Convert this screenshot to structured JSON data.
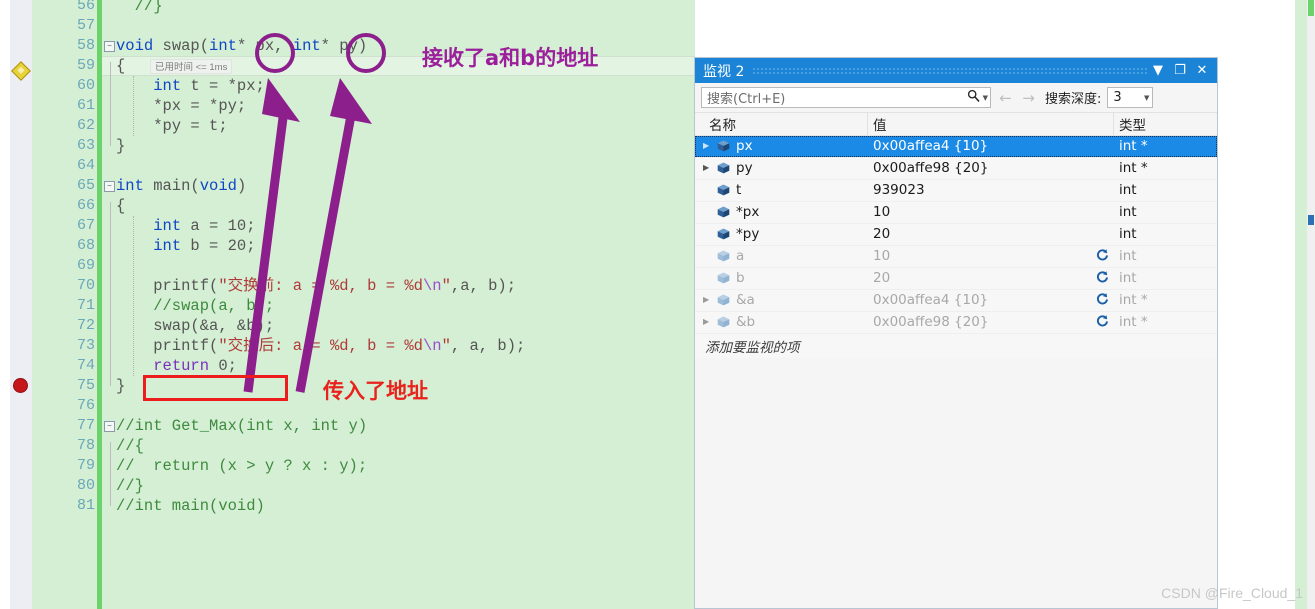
{
  "editor": {
    "language": "c",
    "theme_background": "#d4efd4",
    "first_line": 56,
    "gutter_markers": {
      "current_statement_line": 59,
      "breakpoint_line": 72
    },
    "elapsed_tooltip": "已用时间 <= 1ms",
    "lines": [
      {
        "n": 56,
        "segments": [
          {
            "t": "  //}",
            "c": "cmt"
          }
        ],
        "fold": false
      },
      {
        "n": 57,
        "segments": [
          {
            "t": "",
            "c": "plain"
          }
        ],
        "fold": false
      },
      {
        "n": 58,
        "segments": [
          {
            "t": "void ",
            "c": "kw"
          },
          {
            "t": "swap",
            "c": "plain"
          },
          {
            "t": "(",
            "c": "plain"
          },
          {
            "t": "int",
            "c": "kw"
          },
          {
            "t": "* px, ",
            "c": "plain"
          },
          {
            "t": "int",
            "c": "kw"
          },
          {
            "t": "* py)",
            "c": "plain"
          }
        ],
        "fold": true
      },
      {
        "n": 59,
        "segments": [
          {
            "t": "{",
            "c": "plain"
          }
        ],
        "fold": false
      },
      {
        "n": 60,
        "segments": [
          {
            "t": "    ",
            "c": "plain"
          },
          {
            "t": "int",
            "c": "kw"
          },
          {
            "t": " t = *px;",
            "c": "plain"
          }
        ],
        "fold": false
      },
      {
        "n": 61,
        "segments": [
          {
            "t": "    *px = *py;",
            "c": "plain"
          }
        ],
        "fold": false
      },
      {
        "n": 62,
        "segments": [
          {
            "t": "    *py = t;",
            "c": "plain"
          }
        ],
        "fold": false
      },
      {
        "n": 63,
        "segments": [
          {
            "t": "}",
            "c": "plain"
          }
        ],
        "fold": false
      },
      {
        "n": 64,
        "segments": [
          {
            "t": "",
            "c": "plain"
          }
        ],
        "fold": false
      },
      {
        "n": 65,
        "segments": [
          {
            "t": "int",
            "c": "kw"
          },
          {
            "t": " main(",
            "c": "plain"
          },
          {
            "t": "void",
            "c": "kw"
          },
          {
            "t": ")",
            "c": "plain"
          }
        ],
        "fold": true
      },
      {
        "n": 66,
        "segments": [
          {
            "t": "{",
            "c": "plain"
          }
        ],
        "fold": false
      },
      {
        "n": 67,
        "segments": [
          {
            "t": "    ",
            "c": "plain"
          },
          {
            "t": "int",
            "c": "kw"
          },
          {
            "t": " a = 10;",
            "c": "plain"
          }
        ],
        "fold": false
      },
      {
        "n": 68,
        "segments": [
          {
            "t": "    ",
            "c": "plain"
          },
          {
            "t": "int",
            "c": "kw"
          },
          {
            "t": " b = 20;",
            "c": "plain"
          }
        ],
        "fold": false
      },
      {
        "n": 69,
        "segments": [
          {
            "t": "",
            "c": "plain"
          }
        ],
        "fold": false
      },
      {
        "n": 70,
        "segments": [
          {
            "t": "    printf(",
            "c": "plain"
          },
          {
            "t": "\"交换前: a = %d, b = %d",
            "c": "str"
          },
          {
            "t": "\\n",
            "c": "esc"
          },
          {
            "t": "\"",
            "c": "str"
          },
          {
            "t": ",a, b);",
            "c": "plain"
          }
        ],
        "fold": false
      },
      {
        "n": 71,
        "segments": [
          {
            "t": "    //swap(a, b);",
            "c": "cmt"
          }
        ],
        "fold": false
      },
      {
        "n": 72,
        "segments": [
          {
            "t": "    swap(&a, &b);",
            "c": "plain"
          }
        ],
        "fold": false
      },
      {
        "n": 73,
        "segments": [
          {
            "t": "    printf(",
            "c": "plain"
          },
          {
            "t": "\"交换后: a = %d, b = %d",
            "c": "str"
          },
          {
            "t": "\\n",
            "c": "esc"
          },
          {
            "t": "\"",
            "c": "str"
          },
          {
            "t": ", a, b);",
            "c": "plain"
          }
        ],
        "fold": false
      },
      {
        "n": 74,
        "segments": [
          {
            "t": "    ",
            "c": "plain"
          },
          {
            "t": "return",
            "c": "kw2"
          },
          {
            "t": " 0;",
            "c": "plain"
          }
        ],
        "fold": false
      },
      {
        "n": 75,
        "segments": [
          {
            "t": "}",
            "c": "plain"
          }
        ],
        "fold": false
      },
      {
        "n": 76,
        "segments": [
          {
            "t": "",
            "c": "plain"
          }
        ],
        "fold": false
      },
      {
        "n": 77,
        "segments": [
          {
            "t": "//int Get_Max(int x, int y)",
            "c": "cmt"
          }
        ],
        "fold": true
      },
      {
        "n": 78,
        "segments": [
          {
            "t": "//{",
            "c": "cmt"
          }
        ],
        "fold": false
      },
      {
        "n": 79,
        "segments": [
          {
            "t": "//  return (x > y ? x : y);",
            "c": "cmt"
          }
        ],
        "fold": false
      },
      {
        "n": 80,
        "segments": [
          {
            "t": "//}",
            "c": "cmt"
          }
        ],
        "fold": false
      },
      {
        "n": 81,
        "segments": [
          {
            "t": "//int main(void)",
            "c": "cmt"
          }
        ],
        "fold": false
      }
    ]
  },
  "annotations": {
    "top_note": "接收了a和b的地址",
    "bottom_note": "传入了地址",
    "note_color_purple": "#9b1f9b",
    "note_color_red": "#e8221c",
    "arrow_color": "#8c1f8c",
    "highlight_box_color": "#ee1d1d"
  },
  "watch": {
    "title": "监视 2",
    "title_bar_color": "#1b84d6",
    "buttons": {
      "dropdown": "▼",
      "maximize": "❐",
      "close": "✕"
    },
    "toolbar": {
      "search_placeholder": "搜索(Ctrl+E)",
      "search_value": "",
      "search_icon": "search-icon",
      "back_arrow": "←",
      "forward_arrow": "→",
      "depth_label": "搜索深度:",
      "depth_value": "3"
    },
    "columns": [
      "名称",
      "值",
      "类型"
    ],
    "add_item_placeholder": "添加要监视的项",
    "rows": [
      {
        "name": "px",
        "value": "0x00affea4 {10}",
        "type": "int *",
        "selected": true,
        "stale": false,
        "expandable": true,
        "refresh": false
      },
      {
        "name": "py",
        "value": "0x00affe98 {20}",
        "type": "int *",
        "selected": false,
        "stale": false,
        "expandable": true,
        "refresh": false
      },
      {
        "name": "t",
        "value": "939023",
        "type": "int",
        "selected": false,
        "stale": false,
        "expandable": false,
        "refresh": false
      },
      {
        "name": "*px",
        "value": "10",
        "type": "int",
        "selected": false,
        "stale": false,
        "expandable": false,
        "refresh": false
      },
      {
        "name": "*py",
        "value": "20",
        "type": "int",
        "selected": false,
        "stale": false,
        "expandable": false,
        "refresh": false
      },
      {
        "name": "a",
        "value": "10",
        "type": "int",
        "selected": false,
        "stale": true,
        "expandable": false,
        "refresh": true
      },
      {
        "name": "b",
        "value": "20",
        "type": "int",
        "selected": false,
        "stale": true,
        "expandable": false,
        "refresh": true
      },
      {
        "name": "&a",
        "value": "0x00affea4 {10}",
        "type": "int *",
        "selected": false,
        "stale": true,
        "expandable": true,
        "refresh": true
      },
      {
        "name": "&b",
        "value": "0x00affe98 {20}",
        "type": "int *",
        "selected": false,
        "stale": true,
        "expandable": true,
        "refresh": true
      }
    ]
  },
  "watermark": "CSDN @Fire_Cloud_1"
}
